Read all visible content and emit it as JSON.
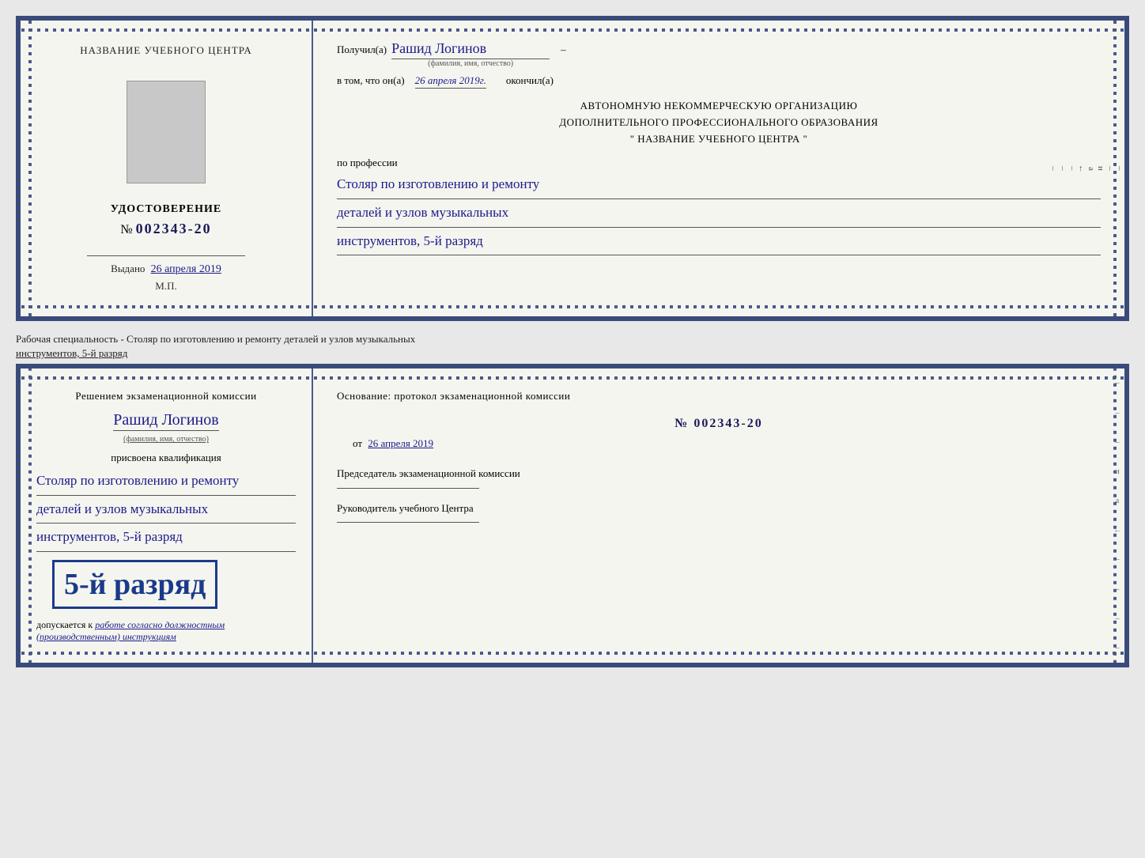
{
  "page": {
    "background_color": "#e8e8e8"
  },
  "top_cert": {
    "left": {
      "center_title": "НАЗВАНИЕ УЧЕБНОГО ЦЕНТРА",
      "cert_title": "УДОСТОВЕРЕНИЕ",
      "cert_number_prefix": "№",
      "cert_number": "002343-20",
      "issued_label": "Выдано",
      "issued_date": "26 апреля 2019",
      "stamp": "М.П."
    },
    "right": {
      "received_label": "Получил(а)",
      "recipient_name": "Рашид Логинов",
      "name_sublabel": "(фамилия, имя, отчество)",
      "in_that_label": "в том, что он(а)",
      "date_handwritten": "26 апреля 2019г.",
      "finished_label": "окончил(а)",
      "org_line1": "АВТОНОМНУЮ НЕКОММЕРЧЕСКУЮ ОРГАНИЗАЦИЮ",
      "org_line2": "ДОПОЛНИТЕЛЬНОГО ПРОФЕССИОНАЛЬНОГО ОБРАЗОВАНИЯ",
      "org_line3": "\"  НАЗВАНИЕ УЧЕБНОГО ЦЕНТРА  \"",
      "by_profession_label": "по профессии",
      "profession_line1": "Столяр по изготовлению и ремонту",
      "profession_line2": "деталей и узлов музыкальных",
      "profession_line3": "инструментов, 5-й разряд",
      "side_marks": [
        "–",
        "–",
        "и",
        "а",
        "←",
        "–",
        "–",
        "–"
      ]
    }
  },
  "label_between": {
    "text_normal": "Рабочая специальность - Столяр по изготовлению и ремонту деталей и узлов музыкальных",
    "text_underlined": "инструментов, 5-й разряд"
  },
  "bottom_cert": {
    "left": {
      "decision_text": "Решением экзаменационной комиссии",
      "recipient_name": "Рашид Логинов",
      "name_sublabel": "(фамилия, имя, отчество)",
      "assigned_label": "присвоена квалификация",
      "qualification_line1": "Столяр по изготовлению и ремонту",
      "qualification_line2": "деталей и узлов музыкальных",
      "qualification_line3": "инструментов, 5-й разряд",
      "big_rank": "5-й разряд",
      "допускается_label": "допускается к",
      "допускается_text": "работе согласно должностным (производственным) инструкциям"
    },
    "right": {
      "basis_label": "Основание: протокол экзаменационной комиссии",
      "protocol_prefix": "№",
      "protocol_number": "002343-20",
      "from_label": "от",
      "from_date": "26 апреля 2019",
      "chairman_label": "Председатель экзаменационной комиссии",
      "director_label": "Руководитель учебного Центра",
      "side_marks": [
        "–",
        "–",
        "–",
        "и",
        "а",
        "←",
        "–",
        "–",
        "–",
        "–"
      ]
    }
  }
}
